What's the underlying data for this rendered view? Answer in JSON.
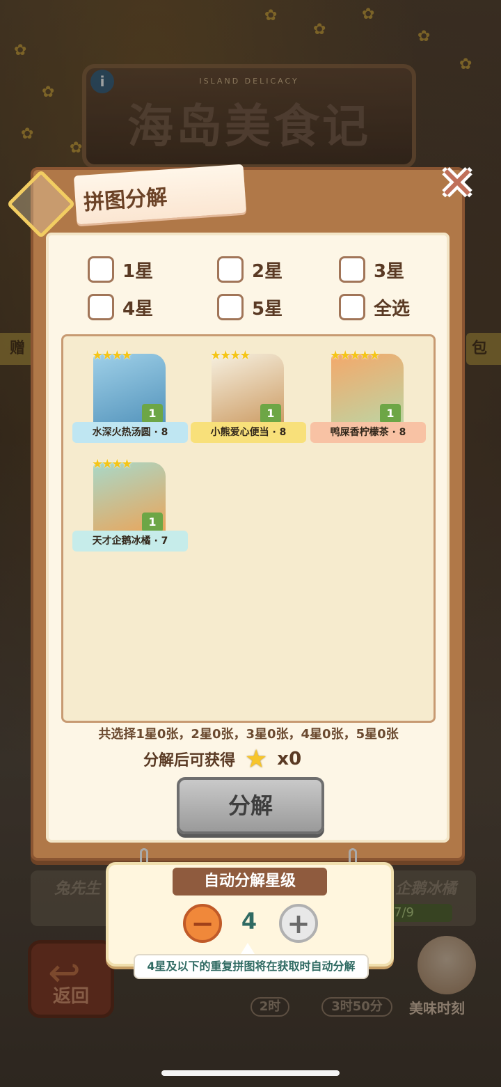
{
  "background": {
    "game_subtitle": "ISLAND DELICACY",
    "game_title": "海岛美食记",
    "info_icon": "info-icon",
    "left_tab": "赠",
    "right_tab": "包",
    "under_left": "兔先生",
    "under_right": "企鹅冰橘",
    "under_progress": "7/9",
    "back_label": "返回",
    "chip_1": "2时",
    "chip_2": "3时50分",
    "taste_label": "美味时刻"
  },
  "modal": {
    "title": "拼图分解",
    "close_icon": "close-x-icon",
    "filters": [
      {
        "label": "1星"
      },
      {
        "label": "2星"
      },
      {
        "label": "3星"
      },
      {
        "label": "4星"
      },
      {
        "label": "5星"
      },
      {
        "label": "全选"
      }
    ],
    "cards": [
      {
        "name": "水深火热汤圆 · 8",
        "stars": "★★★★",
        "count": "1",
        "theme": "#9fd0e8",
        "banner": "#bfe6f2"
      },
      {
        "name": "小熊爱心便当 · 8",
        "stars": "★★★★",
        "count": "1",
        "theme": "#f3d27a",
        "banner": "#f8e07a"
      },
      {
        "name": "鸭屎香柠檬茶 · 8",
        "stars": "★★★★★",
        "count": "1",
        "theme": "#f4b98c",
        "banner": "#f8c2a4"
      },
      {
        "name": "天才企鹅冰橘 · 7",
        "stars": "★★★★",
        "count": "1",
        "theme": "#a8d8c8",
        "banner": "#c6ecea"
      }
    ],
    "summary": "共选择1星0张，2星0张，3星0张，4星0张，5星0张",
    "reward_label": "分解后可获得",
    "reward_icon": "star-icon",
    "reward_count": "x0",
    "decompose_button": "分解"
  },
  "auto_decompose": {
    "title": "自动分解星级",
    "minus_icon": "minus-icon",
    "plus_icon": "plus-icon",
    "level": "4",
    "tooltip": "4星及以下的重复拼图将在获取时自动分解"
  }
}
